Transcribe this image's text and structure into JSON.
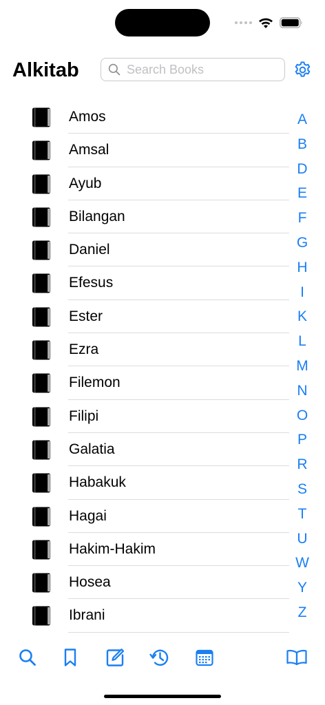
{
  "app": {
    "title": "Alkitab"
  },
  "search": {
    "placeholder": "Search Books",
    "value": ""
  },
  "icons": {
    "settings": "gear-icon",
    "book": "book-icon"
  },
  "colors": {
    "accent": "#1a7ff3",
    "text": "#000000",
    "placeholder": "#c0c0c5",
    "divider": "#dcdce0"
  },
  "books": [
    {
      "name": "Amos"
    },
    {
      "name": "Amsal"
    },
    {
      "name": "Ayub"
    },
    {
      "name": "Bilangan"
    },
    {
      "name": "Daniel"
    },
    {
      "name": "Efesus"
    },
    {
      "name": "Ester"
    },
    {
      "name": "Ezra"
    },
    {
      "name": "Filemon"
    },
    {
      "name": "Filipi"
    },
    {
      "name": "Galatia"
    },
    {
      "name": "Habakuk"
    },
    {
      "name": "Hagai"
    },
    {
      "name": "Hakim-Hakim"
    },
    {
      "name": "Hosea"
    },
    {
      "name": "Ibrani"
    }
  ],
  "index_letters": [
    "A",
    "B",
    "D",
    "E",
    "F",
    "G",
    "H",
    "I",
    "K",
    "L",
    "M",
    "N",
    "O",
    "P",
    "R",
    "S",
    "T",
    "U",
    "W",
    "Y",
    "Z"
  ],
  "tab_bar": [
    {
      "icon": "search-icon"
    },
    {
      "icon": "bookmark-icon"
    },
    {
      "icon": "notes-icon"
    },
    {
      "icon": "history-icon"
    },
    {
      "icon": "calendar-icon"
    },
    {
      "icon": "open-book-icon"
    }
  ]
}
